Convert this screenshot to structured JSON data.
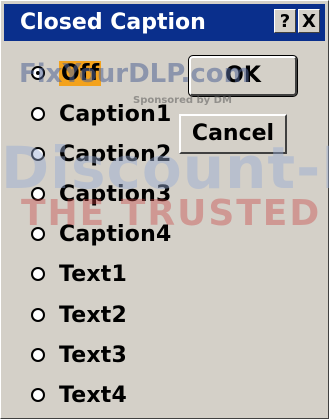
{
  "window": {
    "title": "Closed Caption",
    "help_label": "?",
    "close_label": "X"
  },
  "options": [
    {
      "label": "Off",
      "checked": true
    },
    {
      "label": "Caption1",
      "checked": false
    },
    {
      "label": "Caption2",
      "checked": false
    },
    {
      "label": "Caption3",
      "checked": false
    },
    {
      "label": "Caption4",
      "checked": false
    },
    {
      "label": "Text1",
      "checked": false
    },
    {
      "label": "Text2",
      "checked": false
    },
    {
      "label": "Text3",
      "checked": false
    },
    {
      "label": "Text4",
      "checked": false
    }
  ],
  "buttons": {
    "ok": "OK",
    "cancel": "Cancel"
  },
  "watermark": {
    "site": "FixYourDLP.com",
    "sponsor": "Sponsored by DM",
    "brand": "Discount-M",
    "tagline": "THE TRUSTED SOU"
  },
  "colors": {
    "titlebar": "#0a2f8c",
    "selection": "#f3a21c",
    "face": "#d4d0c8"
  }
}
